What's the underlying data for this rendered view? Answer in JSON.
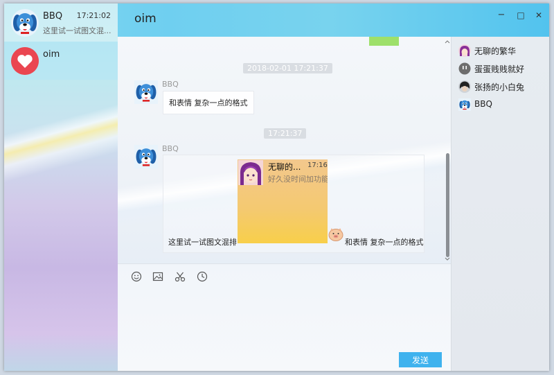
{
  "window": {
    "controls": {
      "minimize": "−",
      "maximize": "□",
      "close": "✕"
    }
  },
  "sessions": [
    {
      "name": "BBQ",
      "time": "17:21:02",
      "preview": "这里试一试图文混..."
    },
    {
      "name": "oim",
      "time": "",
      "preview": ""
    }
  ],
  "chat": {
    "title": "oim",
    "messages": [
      {
        "timestamp": "2018-02-01 17:21:37",
        "sender": "BBQ",
        "text": "和表情 复杂一点的格式"
      },
      {
        "timestamp": "17:21:37",
        "sender": "BBQ",
        "text_before": "这里试一试图文混排",
        "text_after": "和表情 复杂一点的格式",
        "embedded_card": {
          "name": "无聊的...",
          "time": "17:16:",
          "preview": "好久没时间加功能."
        }
      }
    ]
  },
  "input": {
    "toolbar": [
      "emoji-icon",
      "image-icon",
      "scissors-icon",
      "clock-icon"
    ],
    "send_label": "发送"
  },
  "members": [
    {
      "name": "无聊的繁华",
      "icon": "anime-girl-avatar"
    },
    {
      "name": "蛋蛋贱贱就好",
      "icon": "gray-face-avatar"
    },
    {
      "name": "张扬的小白兔",
      "icon": "dark-hair-avatar"
    },
    {
      "name": "BBQ",
      "icon": "blue-dog-avatar"
    }
  ],
  "colors": {
    "titlebar": "#6fcff0",
    "send_button": "#3fb2ee",
    "time_chip": "#d9dde2",
    "scroll_thumb": "#8b8f94"
  }
}
